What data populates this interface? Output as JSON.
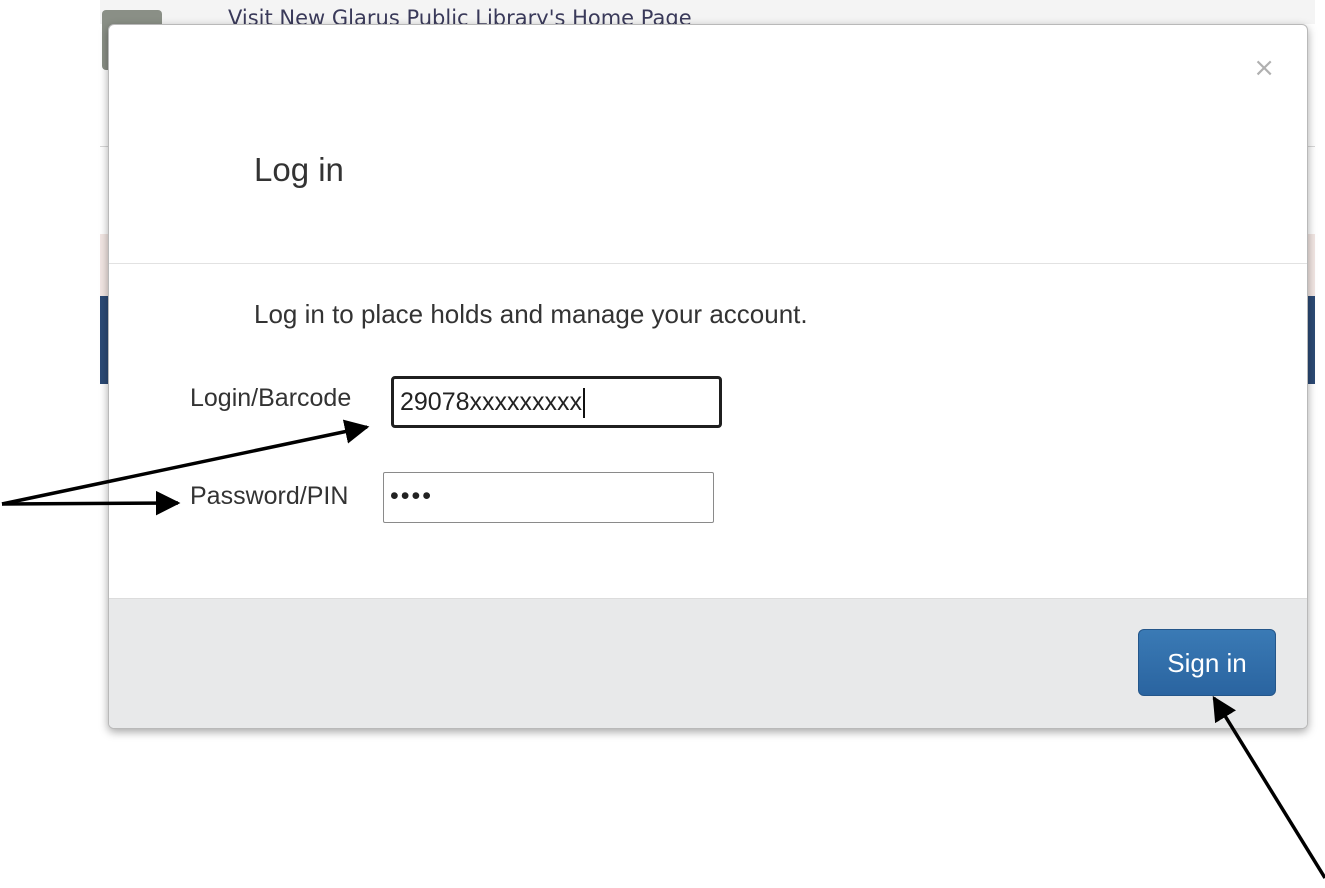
{
  "background": {
    "header_link": "Visit New Glarus Public Library's Home Page"
  },
  "modal": {
    "close_symbol": "×",
    "title": "Log in",
    "intro": "Log in to place holds and manage your account.",
    "barcode": {
      "label": "Login/Barcode",
      "value": "29078xxxxxxxxx"
    },
    "pin": {
      "label": "Password/PIN",
      "value": "••••"
    },
    "submit_label": "Sign in"
  },
  "colors": {
    "primary_button": "#2f6da8",
    "footer_bg": "#e8e9ea",
    "bg_nav": "#2c4a75",
    "arrow": "#000000"
  }
}
